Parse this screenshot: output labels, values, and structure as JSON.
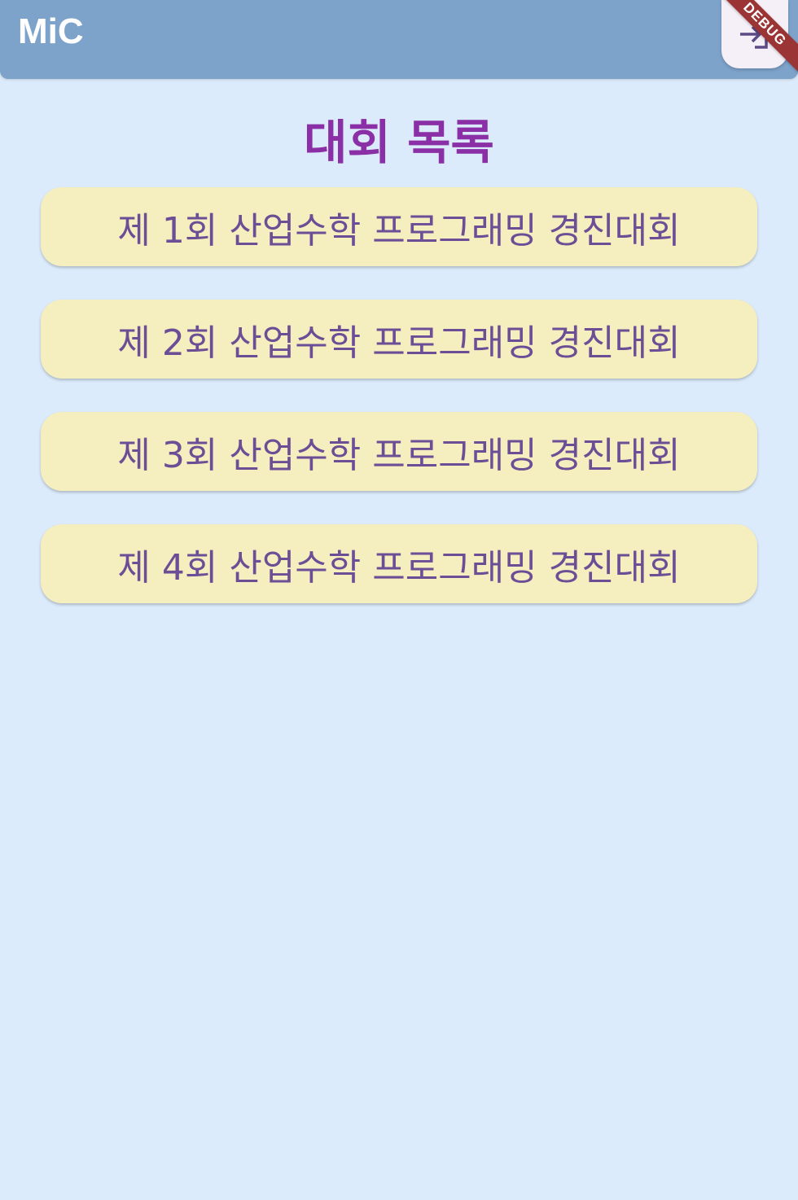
{
  "app_bar": {
    "title": "MiC",
    "action_icon": "logout-icon",
    "debug_label": "DEBUG"
  },
  "page": {
    "title": "대회 목록"
  },
  "contests": [
    {
      "label": "제 1회 산업수학 프로그래밍 경진대회"
    },
    {
      "label": "제 2회 산업수학 프로그래밍 경진대회"
    },
    {
      "label": "제 3회 산업수학 프로그래밍 경진대회"
    },
    {
      "label": "제 4회 산업수학 프로그래밍 경진대회"
    }
  ],
  "colors": {
    "background": "#dcebfb",
    "app_bar": "#7ea3cb",
    "title": "#8a2fa5",
    "card": "#f5eebf",
    "card_text": "#6b4e95",
    "debug_banner": "#9b3434"
  }
}
